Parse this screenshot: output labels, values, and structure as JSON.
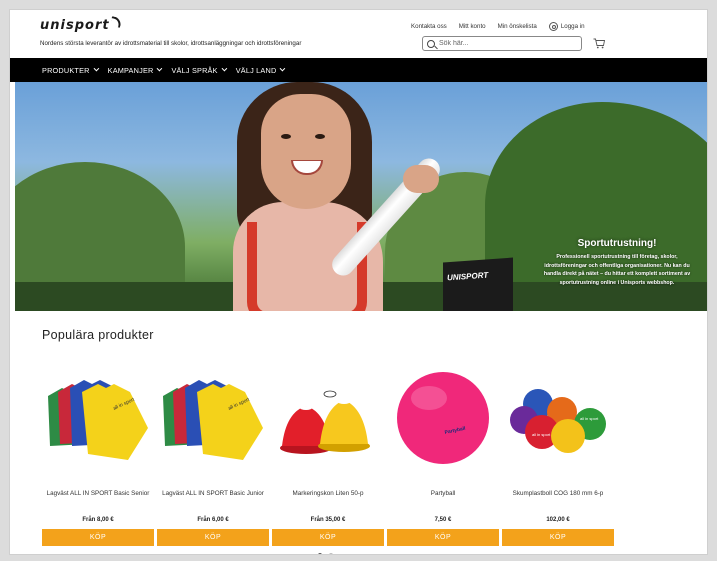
{
  "header": {
    "logo": "unisport",
    "tagline": "Nordens största leverantör av idrottsmaterial till skolor, idrottsanläggningar och idrottsföreningar",
    "links": {
      "contact": "Kontakta oss",
      "account": "Mitt konto",
      "wishlist": "Min önskelista",
      "login": "Logga in"
    },
    "search_placeholder": "Sök här..."
  },
  "nav": {
    "items": [
      "PRODUKTER",
      "KAMPANJER",
      "VÄLJ SPRÅK",
      "VÄLJ LAND"
    ]
  },
  "hero": {
    "banner_brand": "UNISPORT",
    "title": "Sportutrustning!",
    "body": "Professionell sportutrustning till företag, skolor, idrottsföreningar och offentliga organisationer. Nu kan du handla direkt på nätet – du hittar ett komplett sortiment av sportutrustning online i Unisports webbshop."
  },
  "products": {
    "section_title": "Populära produkter",
    "buy_label": "KÖP",
    "items": [
      {
        "name": "Lagväst ALL IN SPORT Basic Senior",
        "price": "Från 8,00 €",
        "image_label": "all in sport"
      },
      {
        "name": "Lagväst ALL IN SPORT Basic Junior",
        "price": "Från 6,00 €",
        "image_label": "all in sport"
      },
      {
        "name": "Markeringskon Liten 50-p",
        "price": "Från 35,00 €"
      },
      {
        "name": "Partyball",
        "price": "7,50 €",
        "image_label": "Partyball"
      },
      {
        "name": "Skumplastboll COG 180 mm 6-p",
        "price": "102,00 €",
        "image_label": "all in sport"
      }
    ]
  },
  "carousel": {
    "pages": 2,
    "active": 1
  },
  "colors": {
    "accent": "#f3a21b",
    "nav_bg": "#000000"
  }
}
